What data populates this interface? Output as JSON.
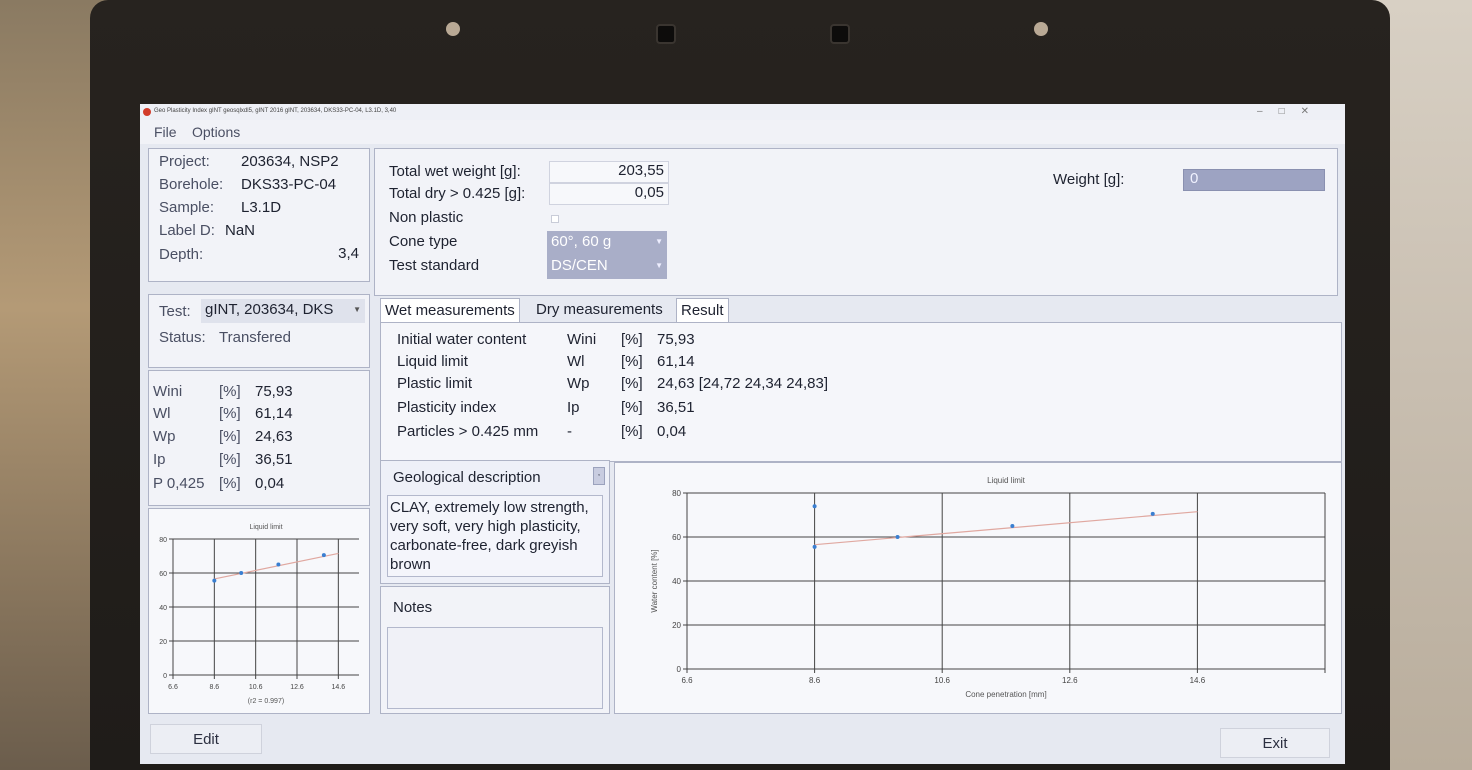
{
  "window": {
    "title": "Geo Plasticity Index gINT geosqlxdl5, gINT 2016 gINT, 203634, DKS33-PC-04, L3.1D, 3,40"
  },
  "menu": [
    "File",
    "Options"
  ],
  "info": {
    "project_label": "Project:",
    "project": "203634, NSP2",
    "borehole_label": "Borehole:",
    "borehole": "DKS33-PC-04",
    "sample_label": "Sample:",
    "sample": "L3.1D",
    "label_d_label": "Label D:",
    "label_d": "NaN",
    "depth_label": "Depth:",
    "depth": "3,4"
  },
  "test": {
    "label": "Test:",
    "value": "gINT, 203634, DKS",
    "status_label": "Status:",
    "status": "Transfered"
  },
  "summary": [
    {
      "sym": "Wini",
      "unit": "[%]",
      "value": "75,93"
    },
    {
      "sym": "Wl",
      "unit": "[%]",
      "value": "61,14"
    },
    {
      "sym": "Wp",
      "unit": "[%]",
      "value": "24,63"
    },
    {
      "sym": "Ip",
      "unit": "[%]",
      "value": "36,51"
    },
    {
      "sym": "P 0,425",
      "unit": "[%]",
      "value": "0,04"
    }
  ],
  "weights": {
    "total_wet_label": "Total wet weight [g]:",
    "total_wet": "203,55",
    "total_dry_label": "Total dry > 0.425 [g]:",
    "total_dry": "0,05",
    "non_plastic_label": "Non plastic",
    "cone_type_label": "Cone type",
    "cone_type": "60°, 60 g",
    "test_standard_label": "Test standard",
    "test_standard": "DS/CEN",
    "weight_label": "Weight [g]:",
    "weight": "0"
  },
  "tabs": [
    "Wet measurements",
    "Dry measurements",
    "Result"
  ],
  "results": [
    {
      "name": "Initial water content",
      "sym": "Wini",
      "unit": "[%]",
      "value": "75,93"
    },
    {
      "name": "Liquid limit",
      "sym": "Wl",
      "unit": "[%]",
      "value": "61,14"
    },
    {
      "name": "Plastic limit",
      "sym": "Wp",
      "unit": "[%]",
      "value": "24,63 [24,72 24,34 24,83]"
    },
    {
      "name": "Plasticity index",
      "sym": "Ip",
      "unit": "[%]",
      "value": "36,51"
    },
    {
      "name": "Particles > 0.425 mm",
      "sym": "-",
      "unit": "[%]",
      "value": "0,04"
    }
  ],
  "geo": {
    "title": "Geological description",
    "text": "CLAY, extremely low strength, very soft, very high plasticity, carbonate-free, dark greyish brown"
  },
  "notes": {
    "title": "Notes",
    "text": ""
  },
  "buttons": {
    "edit": "Edit",
    "exit": "Exit"
  },
  "colors": {
    "screen_bg": "#e6e9f1",
    "panel": "#f2f3f8",
    "combo": "#a9aec8",
    "point": "#3a7fd1",
    "trend": "#e0a8a0"
  },
  "chart_data": [
    {
      "type": "scatter",
      "title": "Liquid limit",
      "xlabel": "Cone penetration [mm]",
      "ylabel": "Water content [%]",
      "xlim": [
        6.6,
        16.6
      ],
      "ylim": [
        0,
        80
      ],
      "x_ticks": [
        "6.6",
        "8.6",
        "10.6",
        "12.6",
        "14.6"
      ],
      "y_ticks": [
        "0",
        "20",
        "40",
        "60",
        "80"
      ],
      "points": [
        {
          "x": 8.6,
          "y": 55.5
        },
        {
          "x": 9.9,
          "y": 60.0
        },
        {
          "x": 11.7,
          "y": 65.0
        },
        {
          "x": 13.9,
          "y": 70.5
        },
        {
          "x": 8.6,
          "y": 74.0
        }
      ],
      "trend": [
        [
          8.6,
          56.5
        ],
        [
          14.6,
          71.5
        ]
      ],
      "grid": true
    },
    {
      "type": "scatter",
      "title": "Liquid limit",
      "xlabel": "(r2 = 0.997)",
      "ylabel": "",
      "xlim": [
        6.6,
        15.6
      ],
      "ylim": [
        0,
        80
      ],
      "x_ticks": [
        "6.6",
        "8.6",
        "10.6",
        "12.6",
        "14.6"
      ],
      "y_ticks": [
        "0",
        "20",
        "40",
        "60",
        "80"
      ],
      "points": [
        {
          "x": 8.6,
          "y": 55.5
        },
        {
          "x": 9.9,
          "y": 60.0
        },
        {
          "x": 11.7,
          "y": 65.0
        },
        {
          "x": 13.9,
          "y": 70.5
        }
      ],
      "trend": [
        [
          8.6,
          56.5
        ],
        [
          14.6,
          71.5
        ]
      ],
      "grid": true
    }
  ]
}
